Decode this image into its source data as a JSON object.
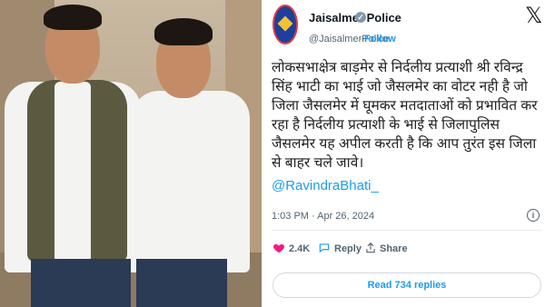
{
  "tweet": {
    "account_name": "Jaisalmer Police",
    "handle": "@JaisalmerPolice",
    "separator": "·",
    "follow_label": "Follow",
    "body": "लोकसभाक्षेत्र बाड़मेर से निर्दलीय प्रत्याशी श्री रविन्द्र सिंह भाटी का भाई जो जैसलमेर का वोटर नही है जो जिला जैसलमेर में घूमकर मतदाताओं को प्रभावित कर रहा है निर्दलीय प्रत्याशी के भाई से जिलापुलिस जैसलमेर यह अपील करती है कि आप तुरंत इस जिला से बाहर चले जावे।",
    "mention": "@RavindraBhati_",
    "timestamp": "1:03 PM · Apr 26, 2024",
    "likes": "2.4K",
    "reply_label": "Reply",
    "share_label": "Share",
    "read_replies_label": "Read 734 replies"
  },
  "icons": {
    "logo": "x-logo-icon",
    "verified": "verified-badge-icon",
    "like": "heart-icon",
    "reply": "reply-icon",
    "share": "share-icon",
    "info": "info-icon"
  },
  "colors": {
    "link": "#1d9bf0",
    "like": "#f91880",
    "text": "#0f1419",
    "muted": "#536471"
  }
}
